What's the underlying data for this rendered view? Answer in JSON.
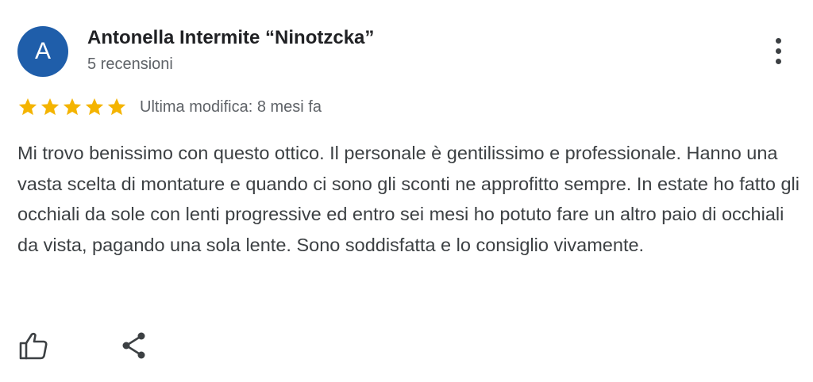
{
  "review": {
    "avatar_initial": "A",
    "avatar_color": "#1f5eaa",
    "author_name": "Antonella Intermite “Ninotzcka”",
    "review_count": "5 recensioni",
    "rating": 5,
    "rating_max": 5,
    "star_color": "#f4b400",
    "modified_label": "Ultima modifica: 8 mesi fa",
    "text": "Mi trovo benissimo con questo ottico. Il personale è gentilissimo e professionale. Hanno una vasta scelta di montature e quando ci sono gli sconti ne approfitto sempre. In estate ho fatto gli occhiali da sole con lenti progressive ed entro sei mesi ho potuto fare un altro paio di occhiali da vista, pagando una sola lente. Sono soddisfatta e lo consiglio vivamente."
  },
  "actions": {
    "more_icon": "more-vert-icon",
    "like_icon": "thumb-up-icon",
    "share_icon": "share-icon"
  }
}
